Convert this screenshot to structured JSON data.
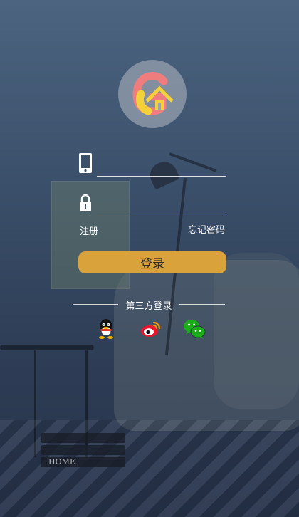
{
  "login": {
    "register_label": "注册",
    "forgot_label": "忘记密码",
    "submit_label": "登录",
    "phone_placeholder": "",
    "password_placeholder": ""
  },
  "third_party": {
    "title": "第三方登录",
    "providers": [
      {
        "name": "qq-icon"
      },
      {
        "name": "weibo-icon"
      },
      {
        "name": "wechat-icon"
      }
    ]
  },
  "background": {
    "book_label": "HOME"
  },
  "colors": {
    "button": "#d9a23b",
    "logo_red": "#ef7d7d",
    "logo_yellow": "#f2d13a"
  }
}
